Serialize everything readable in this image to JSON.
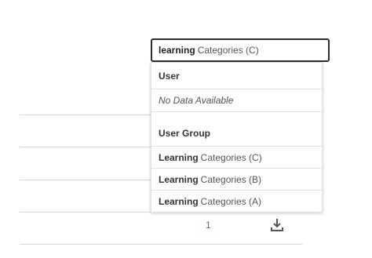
{
  "search": {
    "typed_text": "learning",
    "suggestion_rest": "Categories (C)"
  },
  "dropdown": {
    "user_header": "User",
    "user_empty": "No Data Available",
    "group_header": "User Group",
    "items": [
      {
        "match": "Learning",
        "rest": "Categories (C)"
      },
      {
        "match": "Learning",
        "rest": "Categories (B)"
      },
      {
        "match": "Learning",
        "rest": "Categories (A)"
      }
    ]
  },
  "table": {
    "page_number": "1"
  },
  "icons": {
    "download": "download-icon"
  },
  "colors": {
    "link": "#2f7ab7",
    "input_border": "#2f2f2f"
  }
}
